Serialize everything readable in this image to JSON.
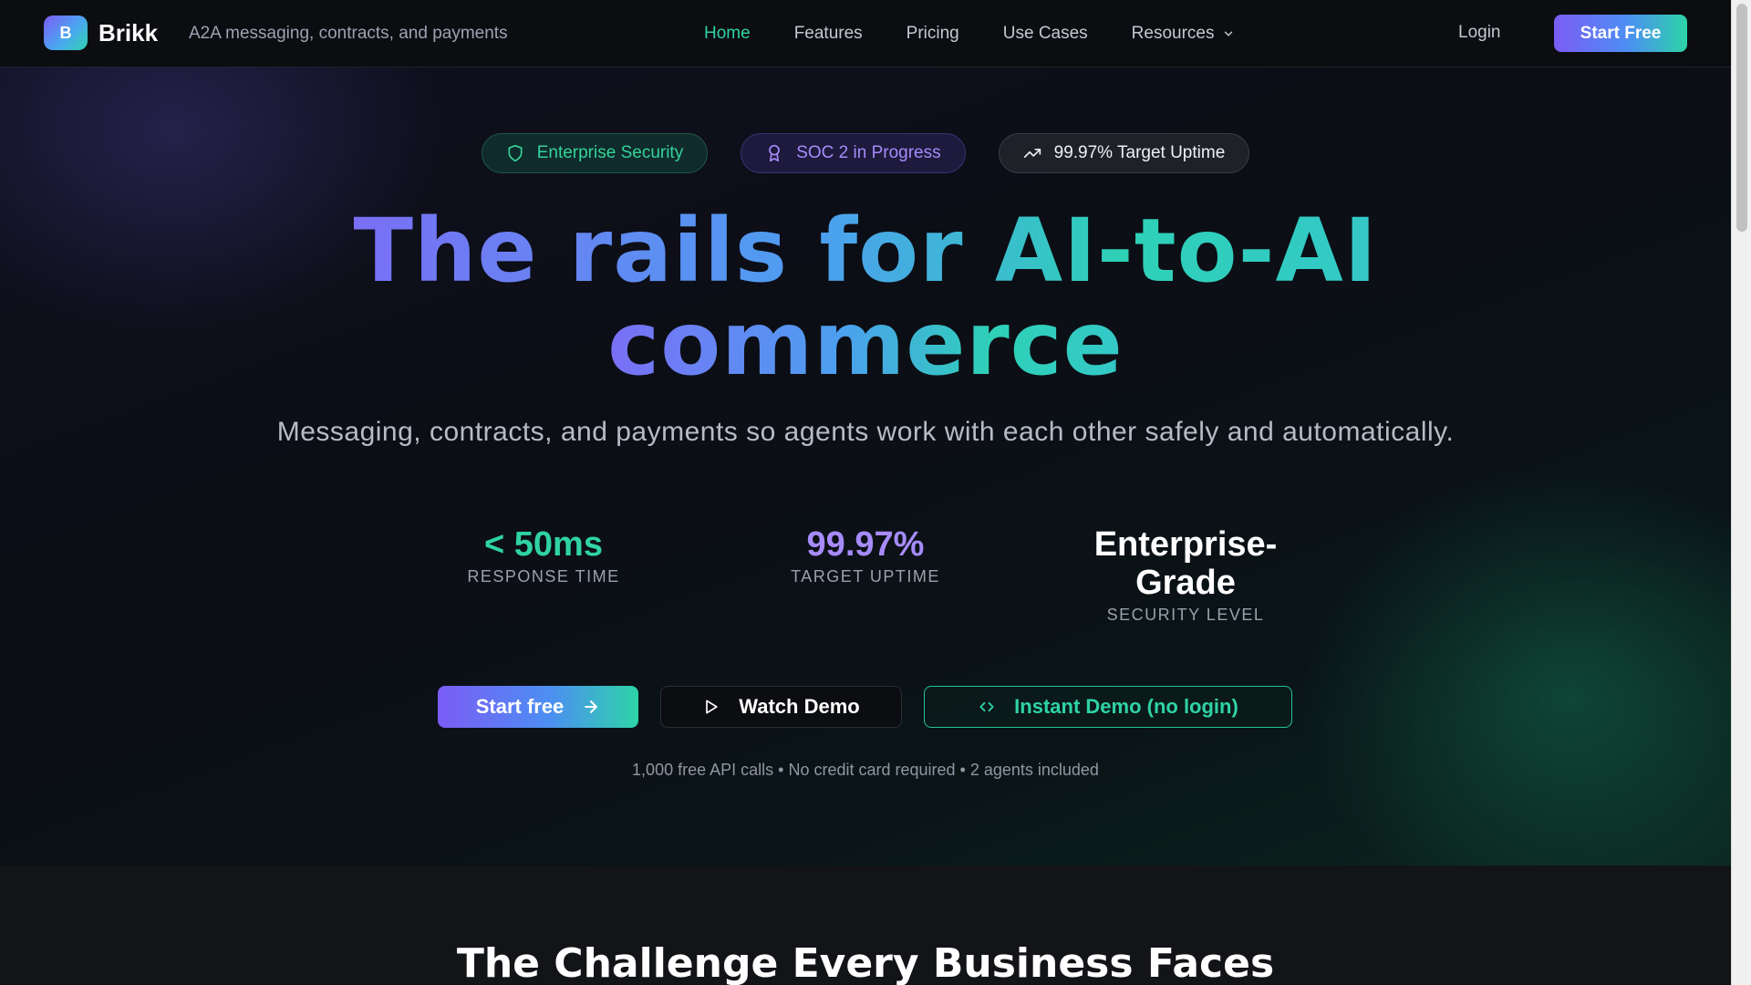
{
  "nav": {
    "logo_letter": "B",
    "brand": "Brikk",
    "tagline": "A2A messaging, contracts, and payments",
    "links": [
      {
        "label": "Home",
        "active": true
      },
      {
        "label": "Features"
      },
      {
        "label": "Pricing"
      },
      {
        "label": "Use Cases"
      },
      {
        "label": "Resources",
        "has_dropdown": true
      }
    ],
    "login": "Login",
    "cta": "Start Free"
  },
  "hero": {
    "badges": [
      {
        "label": "Enterprise Security",
        "icon": "shield-icon"
      },
      {
        "label": "SOC 2 in Progress",
        "icon": "award-icon"
      },
      {
        "label": "99.97% Target Uptime",
        "icon": "trending-up-icon"
      }
    ],
    "headline_line1": "The rails for AI-to-AI",
    "headline_line2": "commerce",
    "subhead": "Messaging, contracts, and payments so agents work with each other safely and automatically.",
    "stats": [
      {
        "value": "< 50ms",
        "label": "RESPONSE TIME"
      },
      {
        "value": "99.97%",
        "label": "TARGET UPTIME"
      },
      {
        "value": "Enterprise-Grade",
        "label": "SECURITY LEVEL"
      }
    ],
    "ctas": {
      "primary": "Start free",
      "secondary": "Watch Demo",
      "outline": "Instant Demo (no login)"
    },
    "fine_print": "1,000 free API calls • No credit card required • 2 agents included"
  },
  "challenge": {
    "title": "The Challenge Every Business Faces"
  },
  "colors": {
    "accent_green": "#2fd3a4",
    "accent_purple": "#a78bfa",
    "background": "#0b0d12"
  }
}
